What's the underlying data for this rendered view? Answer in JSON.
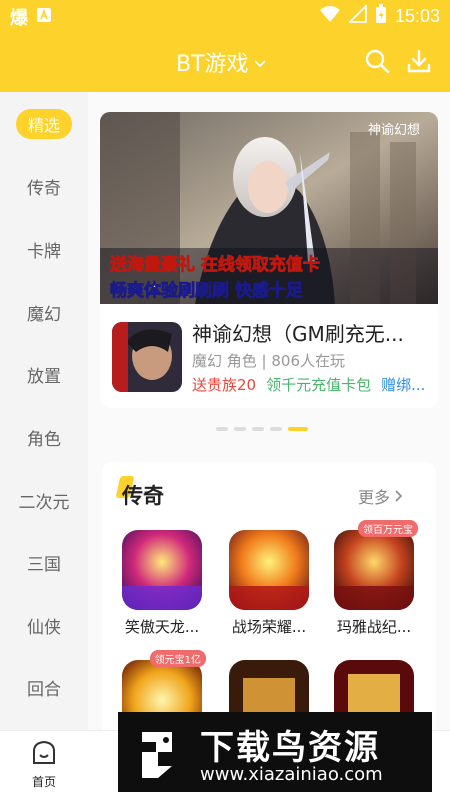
{
  "status": {
    "time": "15:03",
    "left_icon_label": "爆"
  },
  "header": {
    "title": "BT游戏",
    "colors": {
      "accent": "#fdd22a"
    }
  },
  "sidebar": {
    "items": [
      {
        "label": "精选",
        "active": true
      },
      {
        "label": "传奇"
      },
      {
        "label": "卡牌"
      },
      {
        "label": "魔幻"
      },
      {
        "label": "放置"
      },
      {
        "label": "角色"
      },
      {
        "label": "二次元"
      },
      {
        "label": "三国"
      },
      {
        "label": "仙侠"
      },
      {
        "label": "回合"
      }
    ]
  },
  "banner": {
    "image_logo": "神谕幻想",
    "image_line1": "送海量豪礼 在线领取充值卡",
    "image_line2": "畅爽体验刷刷刷 快感十足",
    "game": {
      "name": "神谕幻想（GM刷充无...",
      "meta": "魔幻 角色 | 806人在玩",
      "tags": [
        "送贵族20",
        "领千元充值卡包",
        "赠绑..."
      ]
    }
  },
  "carousel": {
    "pages": 5,
    "active_index": 4
  },
  "section": {
    "title": "传奇",
    "more_label": "更多",
    "games": [
      {
        "name": "笑傲天龙...",
        "badge": ""
      },
      {
        "name": "战场荣耀...",
        "badge": ""
      },
      {
        "name": "玛雅战纪...",
        "badge": "领百万元宝"
      },
      {
        "name": "",
        "badge": "领元宝1亿"
      },
      {
        "name": "",
        "badge": ""
      },
      {
        "name": "",
        "badge": ""
      }
    ]
  },
  "bottom_nav": {
    "home_label": "首页"
  },
  "watermark": {
    "title": "下载鸟资源",
    "url": "www.xiazainiao.com"
  }
}
